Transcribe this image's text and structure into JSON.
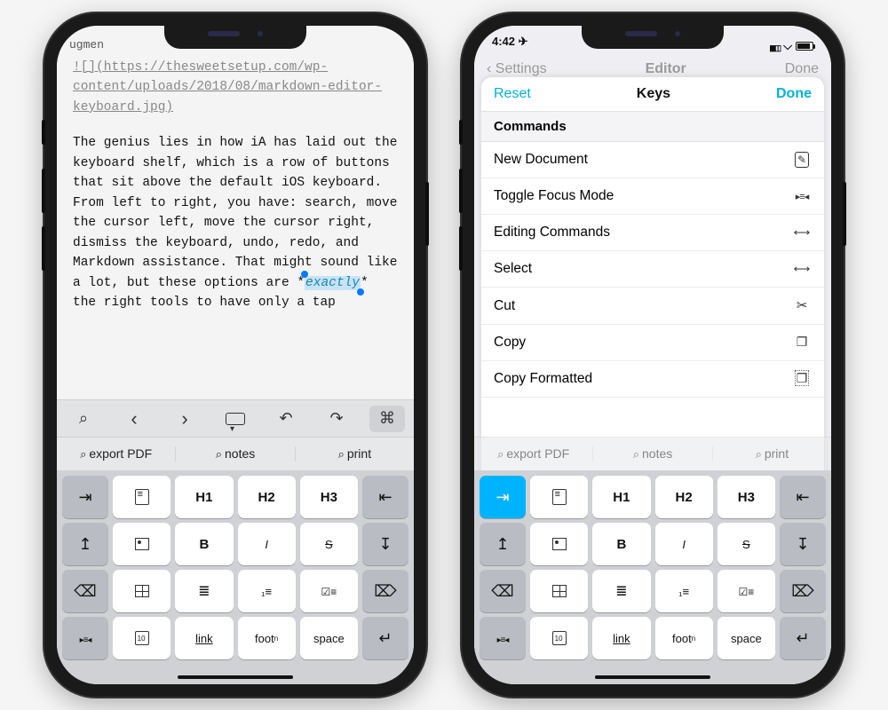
{
  "left": {
    "truncated_header": "ugmen",
    "img_line": "![](https://thesweetsetup.com/wp-content/uploads/2018/08/markdown-editor-keyboard.jpg)",
    "body_pre": "The genius lies in how iA has laid out the keyboard shelf, which is a row of buttons that sit above the default iOS keyboard. From left to right, you have: search, move the cursor left, move the cursor right, dismiss the keyboard, undo, redo, and Markdown assistance. That might sound like a lot, but these options are *",
    "selected": "exactly",
    "body_post": "* the right tools to have only a tap"
  },
  "suggestions": [
    "export PDF",
    "notes",
    "print"
  ],
  "keys": {
    "h1": "H1",
    "h2": "H2",
    "h3": "H3",
    "bold": "B",
    "italic": "I",
    "strike": "S",
    "link": "link",
    "foot": "foot",
    "foot_sup": "n",
    "space": "space"
  },
  "right": {
    "time": "4:42",
    "behind_back": "Settings",
    "behind_title": "Editor",
    "behind_done": "Done",
    "sheet": {
      "reset": "Reset",
      "title": "Keys",
      "done": "Done",
      "section": "Commands",
      "rows": [
        {
          "label": "New Document",
          "icon": "ic-newdoc"
        },
        {
          "label": "Toggle Focus Mode",
          "icon": "ic-focus"
        },
        {
          "label": "Editing Commands",
          "icon": "ic-edit"
        },
        {
          "label": "Select",
          "icon": "ic-select"
        },
        {
          "label": "Cut",
          "icon": "ic-cut"
        },
        {
          "label": "Copy",
          "icon": "ic-copy"
        },
        {
          "label": "Copy Formatted",
          "icon": "ic-copyfmt"
        }
      ]
    }
  }
}
